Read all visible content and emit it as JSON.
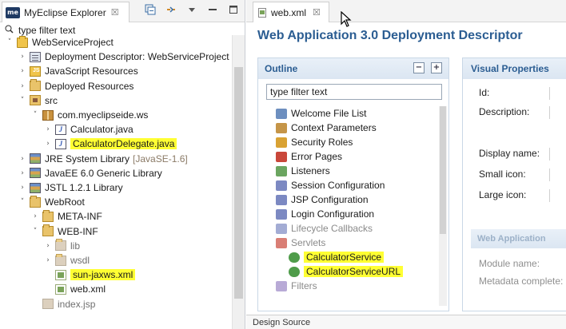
{
  "explorer": {
    "title": "MyEclipse Explorer",
    "app_icon_text": "me",
    "close_glyph": "☒",
    "filter_placeholder": "type filter text",
    "tree": [
      {
        "label": "WebServiceProject",
        "icon": "project",
        "arrow": "down",
        "level": 0
      },
      {
        "label": "Deployment Descriptor: WebServiceProject",
        "icon": "descriptor",
        "arrow": "right",
        "level": 1
      },
      {
        "label": "JavaScript Resources",
        "icon": "js-folder",
        "arrow": "right",
        "level": 1
      },
      {
        "label": "Deployed Resources",
        "icon": "folder",
        "arrow": "right",
        "level": 1
      },
      {
        "label": "src",
        "icon": "source-folder",
        "arrow": "down",
        "level": 1
      },
      {
        "label": "com.myeclipseide.ws",
        "icon": "package",
        "arrow": "down",
        "level": 2
      },
      {
        "label": "Calculator.java",
        "icon": "java-file",
        "arrow": "right",
        "level": 3
      },
      {
        "label": "CalculatorDelegate.java",
        "icon": "java-file",
        "arrow": "right",
        "level": 3,
        "highlight": true
      },
      {
        "label": "JRE System Library",
        "decoration": "[JavaSE-1.6]",
        "icon": "library",
        "arrow": "right",
        "level": 1
      },
      {
        "label": "JavaEE 6.0 Generic Library",
        "icon": "library",
        "arrow": "right",
        "level": 1
      },
      {
        "label": "JSTL 1.2.1 Library",
        "icon": "library",
        "arrow": "right",
        "level": 1
      },
      {
        "label": "WebRoot",
        "icon": "folder",
        "arrow": "down",
        "level": 1
      },
      {
        "label": "META-INF",
        "icon": "folder",
        "arrow": "right",
        "level": 2
      },
      {
        "label": "WEB-INF",
        "icon": "folder",
        "arrow": "down",
        "level": 2
      },
      {
        "label": "lib",
        "icon": "folder",
        "arrow": "right",
        "level": 3,
        "ghost": true
      },
      {
        "label": "wsdl",
        "icon": "folder",
        "arrow": "right",
        "level": 3,
        "ghost": true
      },
      {
        "label": "sun-jaxws.xml",
        "icon": "xml-file",
        "arrow": "",
        "level": 3,
        "highlight": true
      },
      {
        "label": "web.xml",
        "icon": "xml-file",
        "arrow": "",
        "level": 3
      },
      {
        "label": "index.jsp",
        "icon": "jsp-file",
        "arrow": "",
        "level": 2,
        "ghost": true
      }
    ]
  },
  "editor": {
    "tab_label": "web.xml",
    "title": "Web Application 3.0 Deployment Descriptor",
    "outline": {
      "heading": "Outline",
      "filter_placeholder": "type filter text",
      "items": [
        {
          "label": "Welcome File List",
          "icon": "w"
        },
        {
          "label": "Context Parameters",
          "icon": "c"
        },
        {
          "label": "Security Roles",
          "icon": "s"
        },
        {
          "label": "Error Pages",
          "icon": "e"
        },
        {
          "label": "Listeners",
          "icon": "l"
        },
        {
          "label": "Session Configuration",
          "icon": "g"
        },
        {
          "label": "JSP Configuration",
          "icon": "g"
        },
        {
          "label": "Login Configuration",
          "icon": "g"
        },
        {
          "label": "Lifecycle Callbacks",
          "icon": "g",
          "faded": true
        },
        {
          "label": "Servlets",
          "icon": "e",
          "faded": true
        },
        {
          "label": "CalculatorService",
          "icon": "sv",
          "highlight": true
        },
        {
          "label": "CalculatorServiceURL",
          "icon": "sv",
          "highlight": true
        },
        {
          "label": "Filters",
          "icon": "f",
          "faded": true
        }
      ]
    },
    "visual": {
      "heading": "Visual Properties",
      "labels": [
        "Id:",
        "Description:",
        "Display name:",
        "Small icon:",
        "Large icon:"
      ],
      "section": "Web Application",
      "faint_labels": [
        "Module name:",
        "Metadata complete:"
      ]
    },
    "bottom_tabs": "Design  Source"
  }
}
